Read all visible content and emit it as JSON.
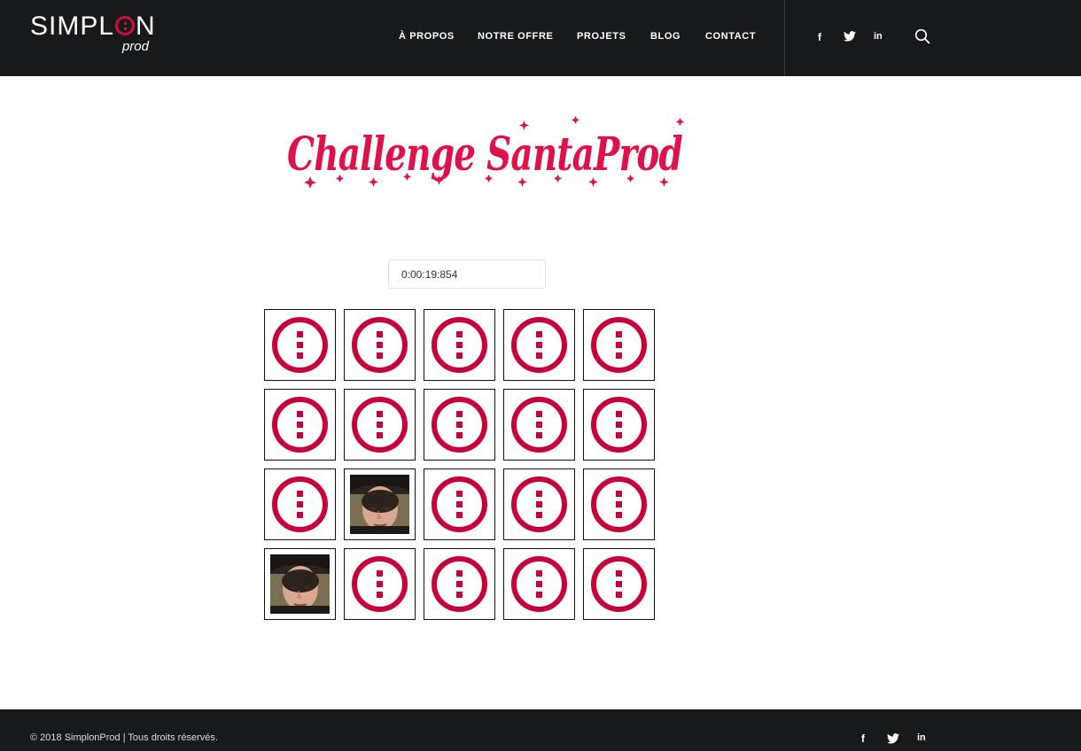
{
  "brand": {
    "name_pre": "SIMPL",
    "name_post": "N",
    "sub": "prod",
    "accent_color": "#d0103a"
  },
  "nav": {
    "items": [
      {
        "label": "À PROPOS"
      },
      {
        "label": "NOTRE OFFRE"
      },
      {
        "label": "PROJETS"
      },
      {
        "label": "BLOG"
      },
      {
        "label": "CONTACT"
      }
    ]
  },
  "social": {
    "facebook": "f",
    "twitter": "twitter-icon",
    "linkedin": "in"
  },
  "banner": {
    "title": "Challenge SantaProd",
    "color": "#e0104a"
  },
  "timer": {
    "value": "0:00:19:854"
  },
  "grid": {
    "rows": 4,
    "cols": 5,
    "cards": [
      "back",
      "back",
      "back",
      "back",
      "back",
      "back",
      "back",
      "back",
      "back",
      "back",
      "back",
      "face",
      "back",
      "back",
      "back",
      "face",
      "back",
      "back",
      "back",
      "back"
    ]
  },
  "footer": {
    "copyright": "© 2018 SimplonProd | Tous droits réservés."
  }
}
